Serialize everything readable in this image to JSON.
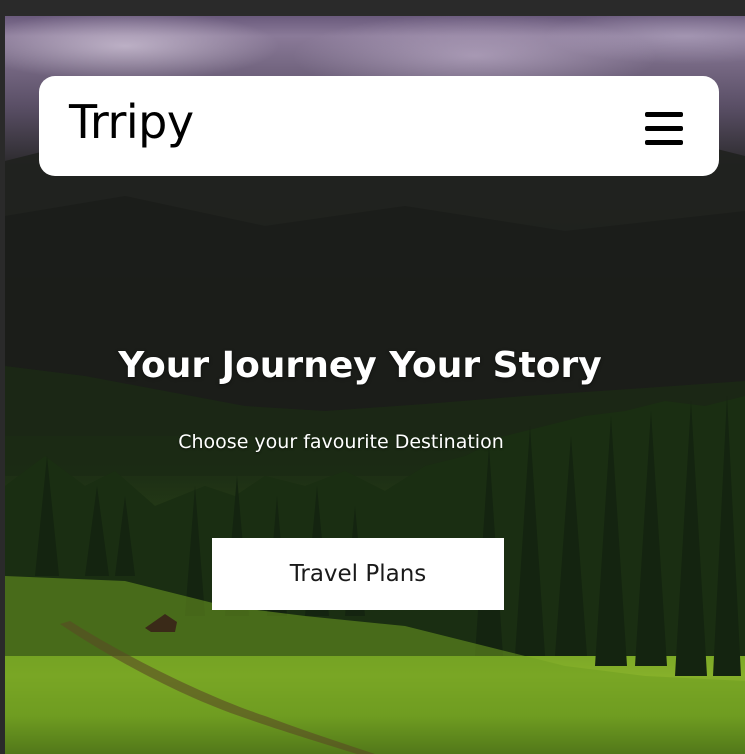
{
  "brand": {
    "name": "Trripy"
  },
  "nav": {
    "menu_icon": "hamburger-menu-icon"
  },
  "hero": {
    "headline": "Your Journey Your Story",
    "subheadline": "Choose your favourite Destination",
    "cta_label": "Travel Plans",
    "background_image": "mountain-forest-meadow-landscape"
  },
  "colors": {
    "navbar_bg": "#ffffff",
    "text_dark": "#000000",
    "text_light": "#ffffff",
    "button_bg": "#ffffff"
  }
}
